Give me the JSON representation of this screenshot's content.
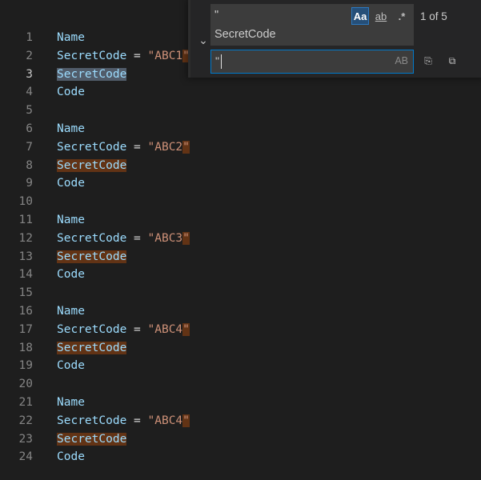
{
  "editor": {
    "lines": [
      {
        "n": "1",
        "tokens": [
          {
            "t": "Name",
            "c": "ident"
          }
        ]
      },
      {
        "n": "2",
        "tokens": [
          {
            "t": "SecretCode",
            "c": "ident"
          },
          {
            "t": " = ",
            "c": "op"
          },
          {
            "t": "\"ABC1",
            "c": "str"
          },
          {
            "t": "\"",
            "c": "str m-other"
          }
        ]
      },
      {
        "n": "3",
        "active": true,
        "tokens": [
          {
            "t": "SecretCode",
            "c": "ident m-cur"
          }
        ]
      },
      {
        "n": "4",
        "tokens": [
          {
            "t": "Code",
            "c": "ident"
          }
        ]
      },
      {
        "n": "5",
        "tokens": []
      },
      {
        "n": "6",
        "tokens": [
          {
            "t": "Name",
            "c": "ident"
          }
        ]
      },
      {
        "n": "7",
        "tokens": [
          {
            "t": "SecretCode",
            "c": "ident"
          },
          {
            "t": " = ",
            "c": "op"
          },
          {
            "t": "\"ABC2",
            "c": "str"
          },
          {
            "t": "\"",
            "c": "str m-other"
          }
        ]
      },
      {
        "n": "8",
        "tokens": [
          {
            "t": "SecretCode",
            "c": "ident m-other"
          }
        ]
      },
      {
        "n": "9",
        "tokens": [
          {
            "t": "Code",
            "c": "ident"
          }
        ]
      },
      {
        "n": "10",
        "tokens": []
      },
      {
        "n": "11",
        "tokens": [
          {
            "t": "Name",
            "c": "ident"
          }
        ]
      },
      {
        "n": "12",
        "tokens": [
          {
            "t": "SecretCode",
            "c": "ident"
          },
          {
            "t": " = ",
            "c": "op"
          },
          {
            "t": "\"ABC3",
            "c": "str"
          },
          {
            "t": "\"",
            "c": "str m-other"
          }
        ]
      },
      {
        "n": "13",
        "tokens": [
          {
            "t": "SecretCode",
            "c": "ident m-other"
          }
        ]
      },
      {
        "n": "14",
        "tokens": [
          {
            "t": "Code",
            "c": "ident"
          }
        ]
      },
      {
        "n": "15",
        "tokens": []
      },
      {
        "n": "16",
        "tokens": [
          {
            "t": "Name",
            "c": "ident"
          }
        ]
      },
      {
        "n": "17",
        "tokens": [
          {
            "t": "SecretCode",
            "c": "ident"
          },
          {
            "t": " = ",
            "c": "op"
          },
          {
            "t": "\"ABC4",
            "c": "str"
          },
          {
            "t": "\"",
            "c": "str m-other"
          }
        ]
      },
      {
        "n": "18",
        "tokens": [
          {
            "t": "SecretCode",
            "c": "ident m-other"
          }
        ]
      },
      {
        "n": "19",
        "tokens": [
          {
            "t": "Code",
            "c": "ident"
          }
        ]
      },
      {
        "n": "20",
        "tokens": []
      },
      {
        "n": "21",
        "tokens": [
          {
            "t": "Name",
            "c": "ident"
          }
        ]
      },
      {
        "n": "22",
        "tokens": [
          {
            "t": "SecretCode",
            "c": "ident"
          },
          {
            "t": " = ",
            "c": "op"
          },
          {
            "t": "\"ABC4",
            "c": "str"
          },
          {
            "t": "\"",
            "c": "str m-other"
          }
        ]
      },
      {
        "n": "23",
        "tokens": [
          {
            "t": "SecretCode",
            "c": "ident m-other"
          }
        ]
      },
      {
        "n": "24",
        "tokens": [
          {
            "t": "Code",
            "c": "ident"
          }
        ]
      }
    ]
  },
  "find_widget": {
    "toggle_icon": "chevron-down",
    "toggle_glyph": "⌄",
    "search_line1": "\"",
    "search_line2": "SecretCode",
    "match_case_label": "Aa",
    "whole_word_label": "ab",
    "regex_label": ".*",
    "match_case_on": true,
    "result_count": "1 of 5",
    "replace_value": "\"",
    "preserve_case_label": "AB",
    "replace_one_icon": "replace-icon",
    "replace_one_glyph": "⎘",
    "replace_all_icon": "replace-all-icon",
    "replace_all_glyph": "⧉"
  },
  "colors": {
    "background": "#1e1e1e",
    "identifier": "#9cdcfe",
    "string": "#ce9178",
    "current_match": "#515c6a",
    "other_match": "#623315",
    "focus_border": "#007acc"
  }
}
